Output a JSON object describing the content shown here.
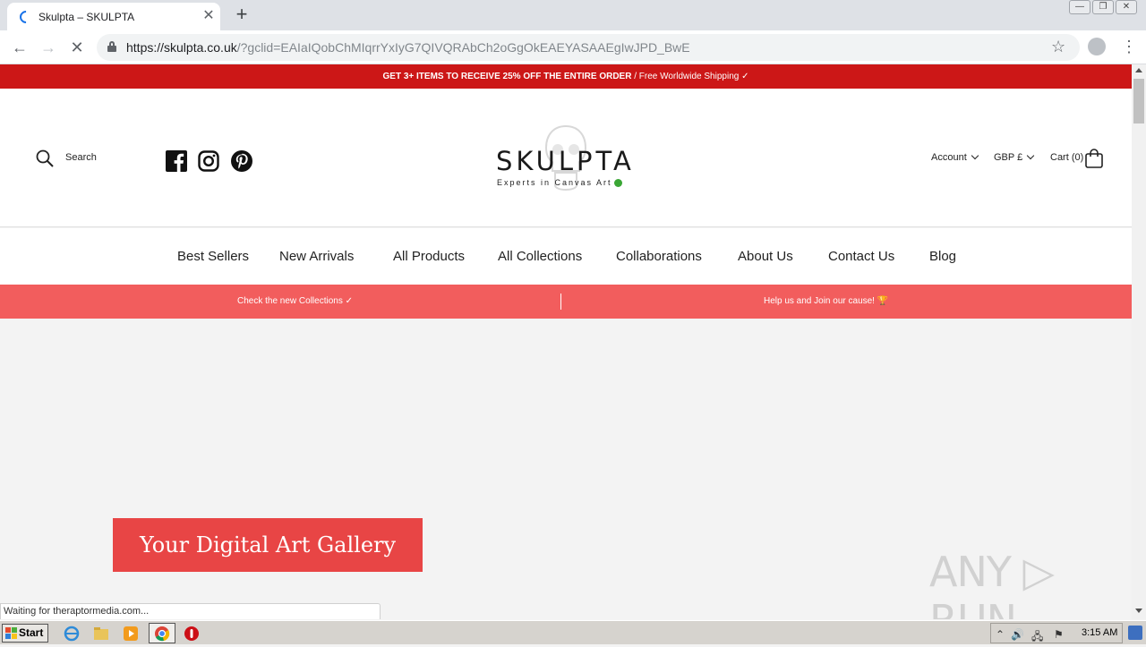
{
  "browser": {
    "tab_title": "Skulpta – SKULPTA",
    "tab_close": "✕",
    "new_tab": "+",
    "url_host": "https://skulpta.co.uk",
    "url_rest": "/?gclid=EAIaIQobChMIqrrYxIyG7QIVQRAbCh2oGgOkEAEYASAAEgIwJPD_BwE",
    "back_icon": "←",
    "forward_icon": "→",
    "reload_icon": "✕",
    "star_icon": "☆",
    "menu_icon": "⋮",
    "win_min": "—",
    "win_restore": "❐",
    "win_close": "✕",
    "status_text": "Waiting for theraptormedia.com..."
  },
  "site": {
    "promo_bold": "GET 3+ ITEMS TO RECEIVE 25% OFF THE ENTIRE ORDER",
    "promo_rest": " / Free Worldwide Shipping ✓",
    "search_label": "Search",
    "logo_text": "SKULPTA",
    "logo_sub": "Experts in Canvas Art",
    "account_label": "Account",
    "currency_label": "GBP £",
    "cart_label": "Cart (0)",
    "nav": [
      "Best Sellers",
      "New Arrivals",
      "All Products",
      "All Collections",
      "Collaborations",
      "About Us",
      "Contact Us",
      "Blog"
    ],
    "subbar_left": "Check the new Collections ✓",
    "subbar_right": "Help us and Join our cause! 🏆",
    "hero_button": "Your Digital Art Gallery",
    "watermark": "ANY ▷ RUN"
  },
  "taskbar": {
    "start_label": "Start",
    "clock": "3:15 AM"
  },
  "colors": {
    "promo_red": "#cc1717",
    "subbar_coral": "#f25d5d",
    "hero_red": "#e84545"
  }
}
